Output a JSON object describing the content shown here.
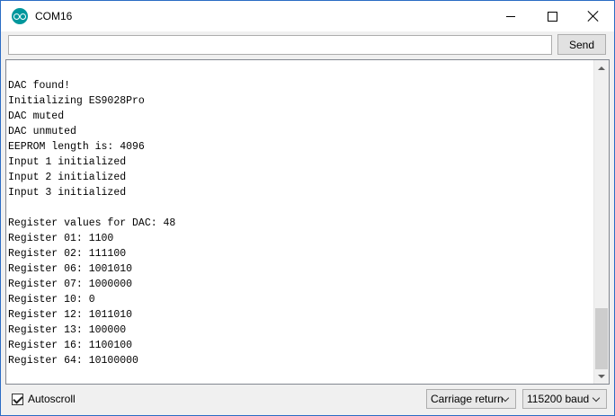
{
  "window": {
    "title": "COM16"
  },
  "send_row": {
    "input_value": "",
    "send_label": "Send"
  },
  "output": {
    "lines": [
      "DAC found!",
      "Initializing ES9028Pro",
      "DAC muted",
      "DAC unmuted",
      "EEPROM length is: 4096",
      "Input 1 initialized",
      "Input 2 initialized",
      "Input 3 initialized",
      "",
      "Register values for DAC: 48",
      "Register 01: 1100",
      "Register 02: 111100",
      "Register 06: 1001010",
      "Register 07: 1000000",
      "Register 10: 0",
      "Register 12: 1011010",
      "Register 13: 100000",
      "Register 16: 1100100",
      "Register 64: 10100000"
    ]
  },
  "bottom": {
    "autoscroll_label": "Autoscroll",
    "autoscroll_checked": true,
    "line_ending": "Carriage return",
    "baud": "115200 baud"
  },
  "colors": {
    "window_border": "#2b6cc4",
    "app_icon": "#00979c"
  }
}
